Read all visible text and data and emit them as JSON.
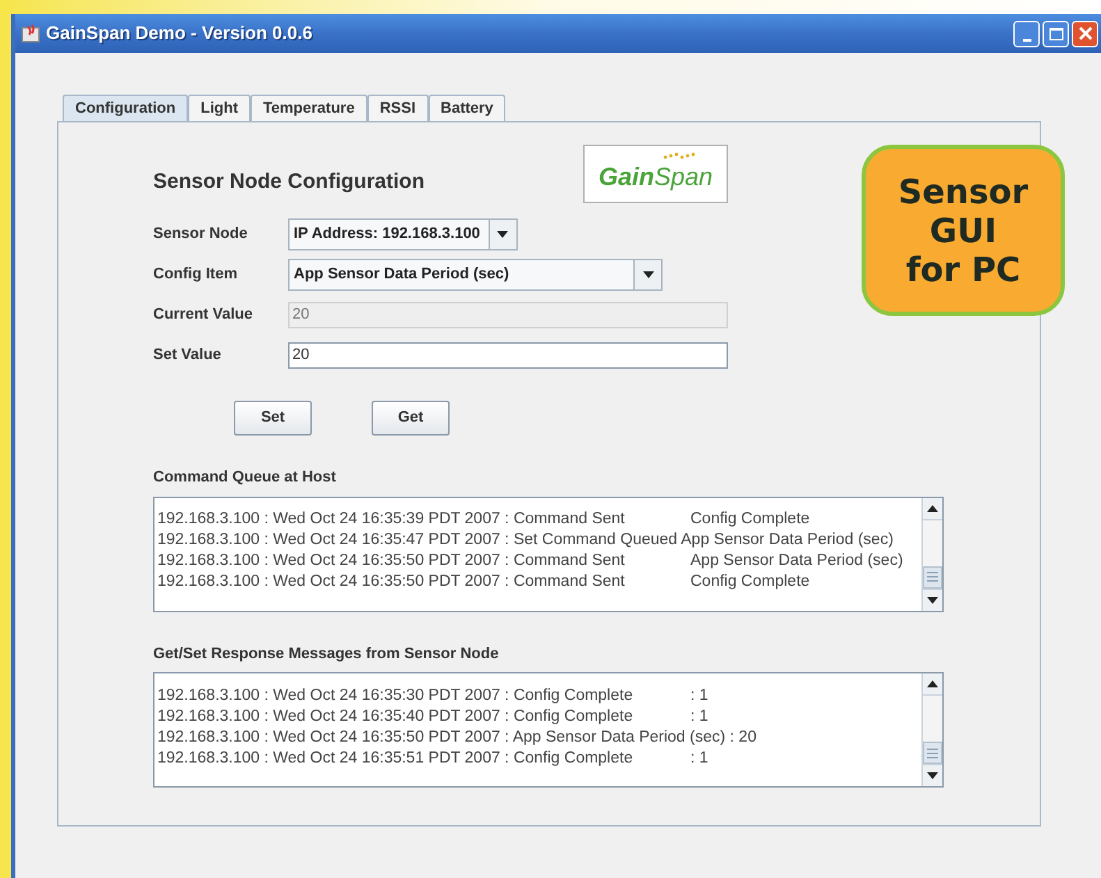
{
  "window": {
    "title": "GainSpan Demo - Version 0.0.6"
  },
  "tabs": [
    {
      "label": "Configuration",
      "selected": true
    },
    {
      "label": "Light",
      "selected": false
    },
    {
      "label": "Temperature",
      "selected": false
    },
    {
      "label": "RSSI",
      "selected": false
    },
    {
      "label": "Battery",
      "selected": false
    }
  ],
  "heading": "Sensor Node Configuration",
  "logo": "**Gain**Span",
  "badge": "Sensor\nGUI\nfor PC",
  "form": [
    {
      "kind": "combo",
      "label": "Sensor Node",
      "value": "IP Address: 192.168.3.100"
    },
    {
      "kind": "wide-combo",
      "label": "Config Item",
      "value": "App Sensor Data Period (sec)"
    },
    {
      "kind": "field",
      "label": "Current Value",
      "value": "20",
      "disabled": true
    },
    {
      "kind": "field",
      "label": "Set Value",
      "value": "20",
      "disabled": false
    }
  ],
  "buttons": [
    "Set",
    "Get"
  ],
  "logs": [
    {
      "title": "Command Queue at Host",
      "rows": [
        {
          "text": "192.168.3.100 : Wed Oct 24 16:35:39 PDT 2007 : Command Sent",
          "detail": "Config Complete"
        },
        {
          "text": "192.168.3.100 : Wed Oct 24 16:35:47 PDT 2007 : Set Command Queued App Sensor Data Period (sec)"
        },
        {
          "text": "192.168.3.100 : Wed Oct 24 16:35:50 PDT 2007 : Command Sent",
          "detail": "App Sensor Data Period (sec)"
        },
        {
          "text": "192.168.3.100 : Wed Oct 24 16:35:50 PDT 2007 : Command Sent",
          "detail": "Config Complete"
        }
      ]
    },
    {
      "title": "Get/Set Response Messages from Sensor Node",
      "rows": [
        {
          "text": "192.168.3.100 : Wed Oct 24 16:35:30 PDT 2007 : Config Complete",
          "detail": ": 1"
        },
        {
          "text": "192.168.3.100 : Wed Oct 24 16:35:40 PDT 2007 : Config Complete",
          "detail": ": 1"
        },
        {
          "text": "192.168.3.100 : Wed Oct 24 16:35:50 PDT 2007 : App Sensor Data Period (sec)  : 20"
        },
        {
          "text": "192.168.3.100 : Wed Oct 24 16:35:51 PDT 2007 : Config Complete",
          "detail": ": 1"
        }
      ]
    }
  ]
}
